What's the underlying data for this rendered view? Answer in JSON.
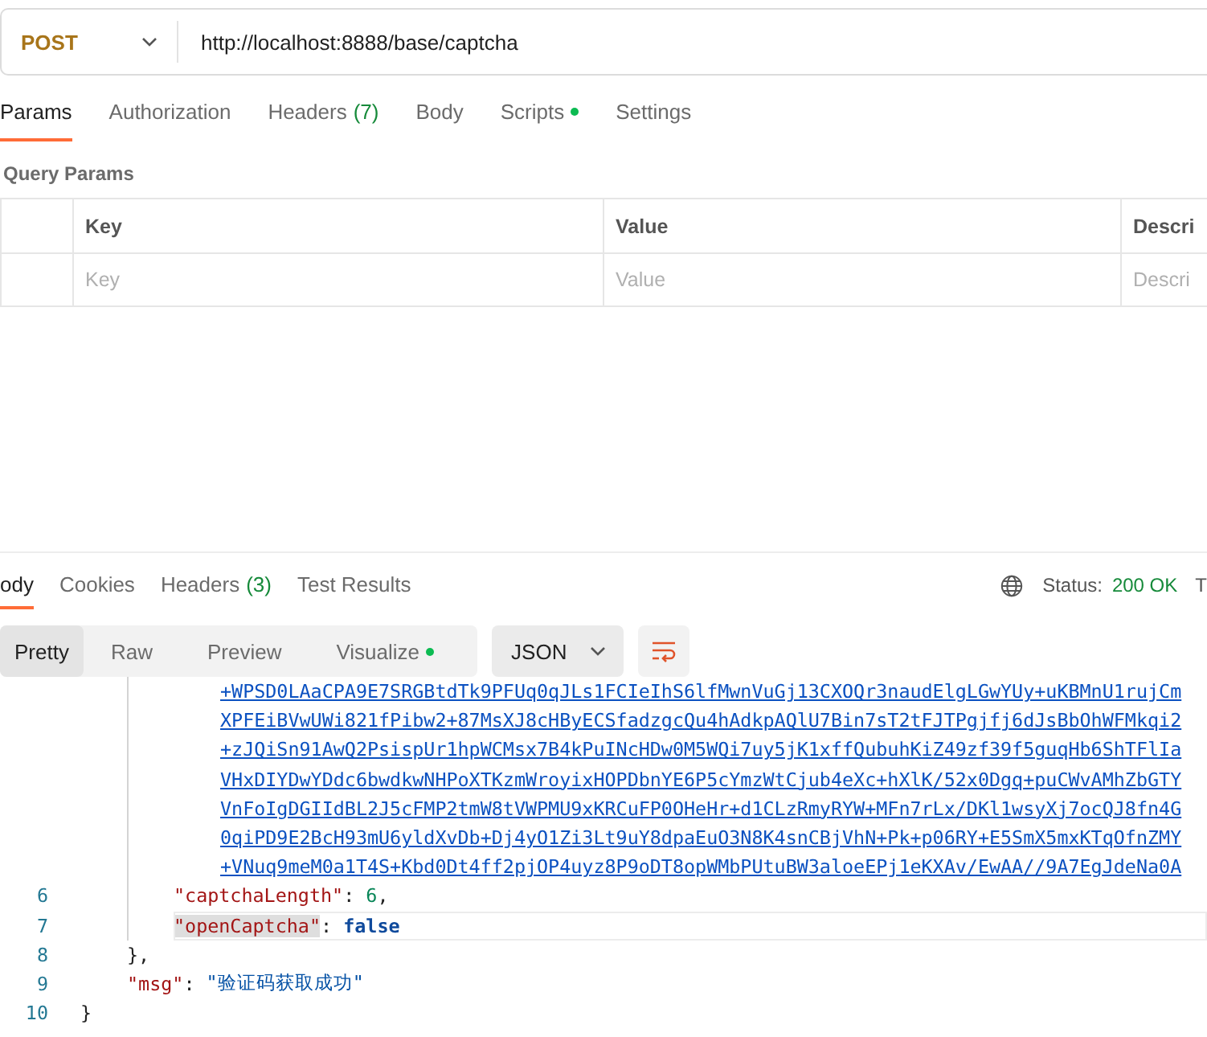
{
  "request": {
    "method": "POST",
    "url": "http://localhost:8888/base/captcha"
  },
  "request_tabs": [
    {
      "label": "Params",
      "selected": true
    },
    {
      "label": "Authorization",
      "selected": false
    },
    {
      "label": "Headers",
      "count": "(7)",
      "selected": false
    },
    {
      "label": "Body",
      "selected": false
    },
    {
      "label": "Scripts",
      "dot": true,
      "selected": false
    },
    {
      "label": "Settings",
      "selected": false
    }
  ],
  "query_params": {
    "title": "Query Params",
    "columns": [
      "Key",
      "Value",
      "Descri"
    ],
    "placeholders": [
      "Key",
      "Value",
      "Descri"
    ]
  },
  "response_tabs": [
    {
      "label": "ody",
      "selected": true
    },
    {
      "label": "Cookies",
      "selected": false
    },
    {
      "label": "Headers",
      "count": "(3)",
      "selected": false
    },
    {
      "label": "Test Results",
      "selected": false
    }
  ],
  "status": {
    "label": "Status:",
    "value": "200 OK",
    "cut_text": "T"
  },
  "view_modes": [
    {
      "label": "Pretty",
      "selected": true
    },
    {
      "label": "Raw",
      "selected": false
    },
    {
      "label": "Preview",
      "selected": false
    },
    {
      "label": "Visualize",
      "dot": true,
      "selected": false
    }
  ],
  "format": "JSON",
  "code": {
    "close_number": "10",
    "close_text": "}",
    "children": [
      {
        "kind": "object",
        "close_number": "8",
        "close_text": "},",
        "children": [
          {
            "kind": "continuation",
            "text": "+WPSD0LAaCPA9E7SRGBtdTk9PFUq0qJLs1FCIeIhS6lfMwnVuGj13CXOQr3naudElgLGwYUy+uKBMnU1rujCm"
          },
          {
            "kind": "continuation",
            "text": "XPFEiBVwUWi821fPibw2+87MsXJ8cHByECSfadzgcQu4hAdkpAQlU7Bin7sT2tFJTPgjfj6dJsBbOhWFMkqi2"
          },
          {
            "kind": "continuation",
            "text": "+zJQiSn91AwQ2PsispUr1hpWCMsx7B4kPuINcHDw0M5WQi7uy5jK1xffQubuhKiZ49zf39f5guqHb6ShTFlIa"
          },
          {
            "kind": "continuation",
            "text": "VHxDIYDwYDdc6bwdkwNHPoXTKzmWroyixHOPDbnYE6P5cYmzWtCjub4eXc+hXlK/52x0Dgq+puCWvAMhZbGTY"
          },
          {
            "kind": "continuation",
            "text": "VnFoIgDGIIdBL2J5cFMP2tmW8tVWPMU9xKRCuFP0OHeHr+d1CLzRmyRYW+MFn7rLx/DKl1wsyXj7ocQJ8fn4G"
          },
          {
            "kind": "continuation",
            "text": "0qiPD9E2BcH93mU6yldXvDb+Dj4yO1Zi3Lt9uY8dpaEuO3N8K4snCBjVhN+Pk+p06RY+E5SmX5mxKTqOfnZMY"
          },
          {
            "kind": "continuation",
            "text": "+VNuq9meM0a1T4S+Kbd0Dt4ff2pjOP4uyz8P9oDT8opWMbPUtuBW3aloeEPj1eKXAv/EwAA//9A7EgJdeNa0A"
          },
          {
            "kind": "member",
            "number": "6",
            "key": "\"captchaLength\"",
            "sep": ":",
            "value": {
              "kind": "number",
              "text": "6"
            },
            "trail": ",",
            "current": false,
            "key_highlighted": false
          },
          {
            "kind": "member",
            "number": "7",
            "key": "\"openCaptcha\"",
            "sep": ":",
            "value": {
              "kind": "boolean",
              "text": "false"
            },
            "current": true,
            "key_highlighted": true
          }
        ]
      },
      {
        "kind": "member",
        "number": "9",
        "key": "\"msg\"",
        "sep": ":",
        "value": {
          "kind": "string",
          "text": "\"验证码获取成功\""
        },
        "current": false,
        "key_highlighted": false
      }
    ]
  }
}
